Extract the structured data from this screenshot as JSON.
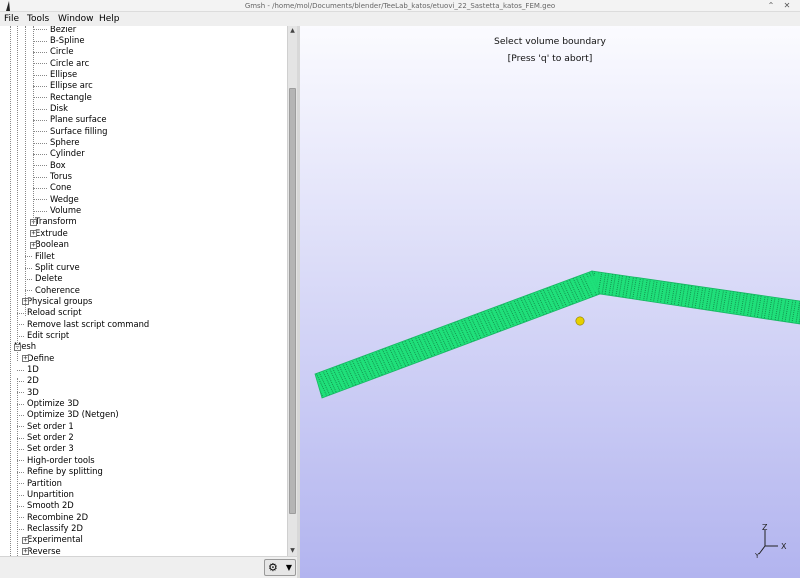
{
  "window": {
    "title": "Gmsh - /home/mol/Documents/blender/TeeLab_katos/etuovi_22_Sastetta_katos_FEM.geo",
    "controls": [
      "⌃",
      "✕"
    ]
  },
  "menubar": [
    "File",
    "Tools",
    "Window",
    "Help"
  ],
  "tree": [
    {
      "label": "Bezier",
      "level": 3
    },
    {
      "label": "B-Spline",
      "level": 3
    },
    {
      "label": "Circle",
      "level": 3
    },
    {
      "label": "Circle arc",
      "level": 3
    },
    {
      "label": "Ellipse",
      "level": 3
    },
    {
      "label": "Ellipse arc",
      "level": 3
    },
    {
      "label": "Rectangle",
      "level": 3
    },
    {
      "label": "Disk",
      "level": 3
    },
    {
      "label": "Plane surface",
      "level": 3
    },
    {
      "label": "Surface filling",
      "level": 3
    },
    {
      "label": "Sphere",
      "level": 3
    },
    {
      "label": "Cylinder",
      "level": 3
    },
    {
      "label": "Box",
      "level": 3
    },
    {
      "label": "Torus",
      "level": 3
    },
    {
      "label": "Cone",
      "level": 3
    },
    {
      "label": "Wedge",
      "level": 3
    },
    {
      "label": "Volume",
      "level": 3
    },
    {
      "label": "Transform",
      "level": 2,
      "expander": "+"
    },
    {
      "label": "Extrude",
      "level": 2,
      "expander": "+"
    },
    {
      "label": "Boolean",
      "level": 2,
      "expander": "+"
    },
    {
      "label": "Fillet",
      "level": 2
    },
    {
      "label": "Split curve",
      "level": 2
    },
    {
      "label": "Delete",
      "level": 2
    },
    {
      "label": "Coherence",
      "level": 2
    },
    {
      "label": "Physical groups",
      "level": 1,
      "expander": "+"
    },
    {
      "label": "Reload script",
      "level": 1
    },
    {
      "label": "Remove last script command",
      "level": 1
    },
    {
      "label": "Edit script",
      "level": 1
    },
    {
      "label": "Mesh",
      "level": 0,
      "expander": "−"
    },
    {
      "label": "Define",
      "level": 1,
      "expander": "+"
    },
    {
      "label": "1D",
      "level": 1
    },
    {
      "label": "2D",
      "level": 1
    },
    {
      "label": "3D",
      "level": 1
    },
    {
      "label": "Optimize 3D",
      "level": 1
    },
    {
      "label": "Optimize 3D (Netgen)",
      "level": 1
    },
    {
      "label": "Set order 1",
      "level": 1
    },
    {
      "label": "Set order 2",
      "level": 1
    },
    {
      "label": "Set order 3",
      "level": 1
    },
    {
      "label": "High-order tools",
      "level": 1
    },
    {
      "label": "Refine by splitting",
      "level": 1
    },
    {
      "label": "Partition",
      "level": 1
    },
    {
      "label": "Unpartition",
      "level": 1
    },
    {
      "label": "Smooth 2D",
      "level": 1
    },
    {
      "label": "Recombine 2D",
      "level": 1
    },
    {
      "label": "Reclassify 2D",
      "level": 1
    },
    {
      "label": "Experimental",
      "level": 1,
      "expander": "+"
    },
    {
      "label": "Reverse",
      "level": 1,
      "expander": "+"
    }
  ],
  "footer": {
    "gear_icon": "⚙",
    "caret": "▼"
  },
  "viewport": {
    "message_line1": "Select volume boundary",
    "message_line2": "[Press 'q' to abort]",
    "axes": {
      "z": "Z",
      "x": "X",
      "y": "Y"
    },
    "mesh_color": "#1fe07a",
    "point_color": "#e0c800"
  }
}
